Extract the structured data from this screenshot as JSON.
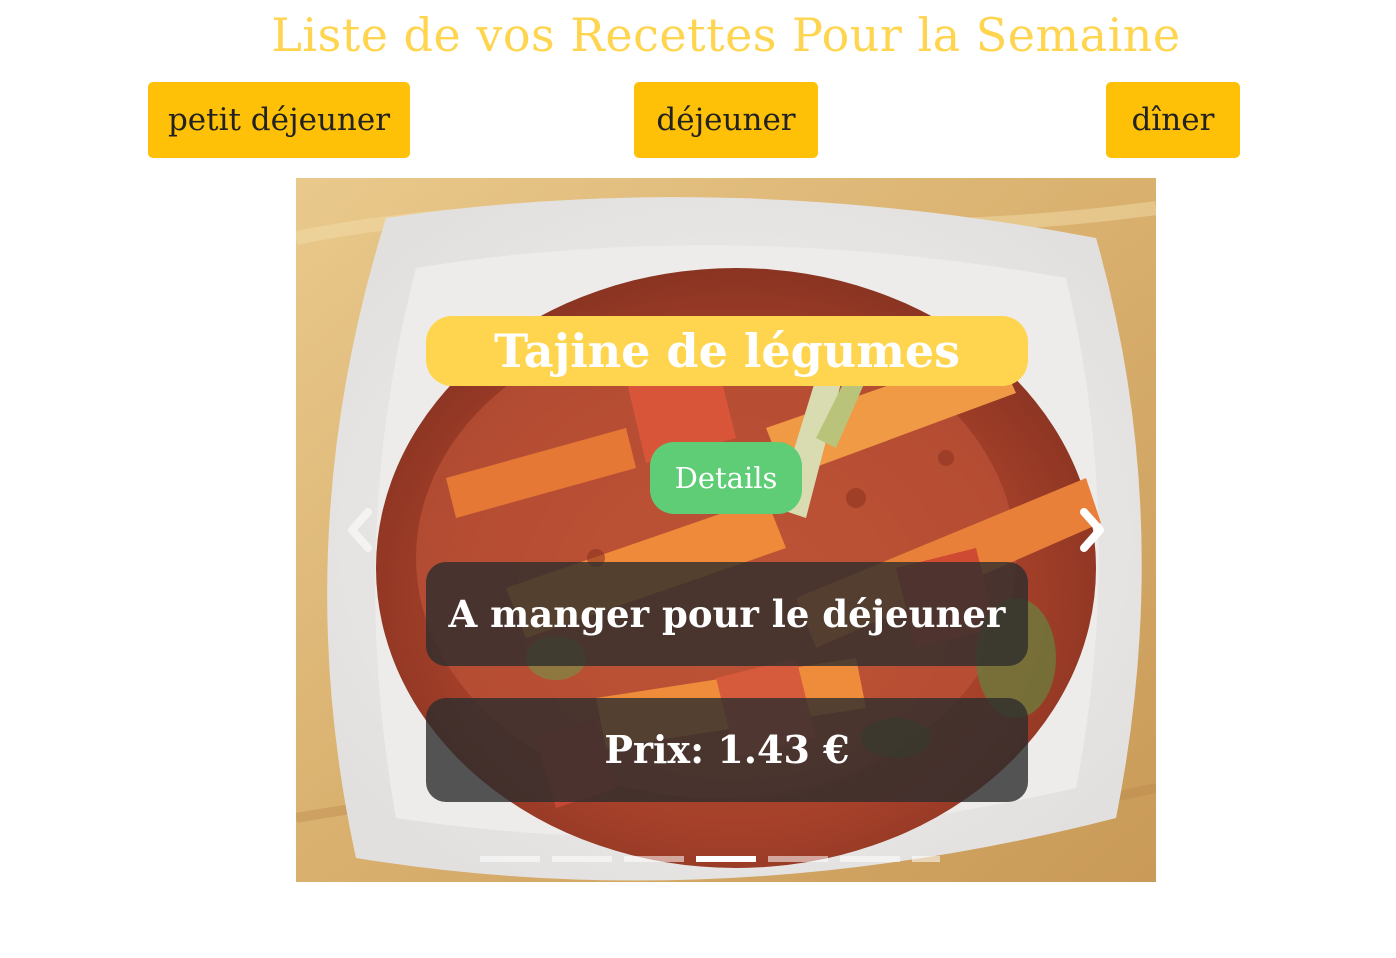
{
  "page": {
    "title": "Liste de vos Recettes Pour la Semaine"
  },
  "meal_buttons": {
    "breakfast": "petit déjeuner",
    "lunch": "déjeuner",
    "dinner": "dîner"
  },
  "carousel": {
    "recipe_name": "Tajine de légumes",
    "details_label": "Details",
    "meal_info": "A manger pour le déjeuner",
    "price": "Prix: 1.43 €",
    "slide_count": 7,
    "active_slide": 4,
    "icons": {
      "prev": "chevron-left-icon",
      "next": "chevron-right-icon"
    }
  },
  "colors": {
    "title": "#ffd54f",
    "meal_button": "#ffc107",
    "recipe_name_bg": "#ffd54f",
    "details_button": "#5ecd76",
    "info_box_bg": "#2d2d2d"
  }
}
